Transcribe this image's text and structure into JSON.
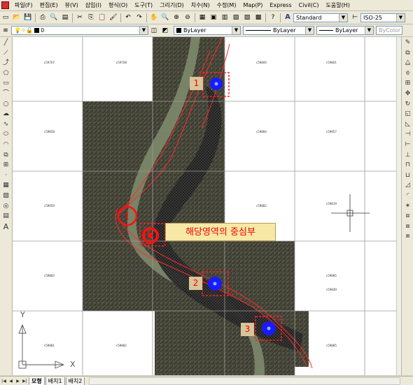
{
  "menu": {
    "items": [
      "파일(F)",
      "편집(E)",
      "뷰(V)",
      "삽입(I)",
      "형식(O)",
      "도구(T)",
      "그리기(D)",
      "치수(N)",
      "수정(M)",
      "Map(P)",
      "Express",
      "Civil(C)",
      "도움말(H)"
    ]
  },
  "toolbar": {
    "text_style": "Standard",
    "dim_style": "ISO-25",
    "layer": "0",
    "color": "ByLayer",
    "linetype": "ByLayer",
    "lineweight": "ByLayer",
    "plot_style": "ByColor"
  },
  "map": {
    "markers": [
      {
        "label": "1"
      },
      {
        "label": "2"
      },
      {
        "label": "3"
      }
    ],
    "center_label": "해당영역의 중심부",
    "sheet_ids": [
      "c59707",
      "c59708",
      "c59800",
      "c59801",
      "c59858",
      "c59884",
      "c59857",
      "c59859",
      "c59882",
      "c59819",
      "c59883",
      "c59885",
      "c59849",
      "c59881",
      "c59882",
      "c59885"
    ]
  },
  "ucs": {
    "x_label": "X",
    "y_label": "Y"
  },
  "tabs": [
    "모형",
    "배치1",
    "배치2"
  ],
  "icons": {
    "app": "autocad-icon",
    "nav": [
      "first-icon",
      "prev-icon",
      "next-icon",
      "last-icon"
    ]
  },
  "colors": {
    "marker_fill": "#1a1aff",
    "outline_red": "#ff1a1a",
    "label_bg": "#d8c59a",
    "center_label_bg": "#f7e9a5"
  }
}
